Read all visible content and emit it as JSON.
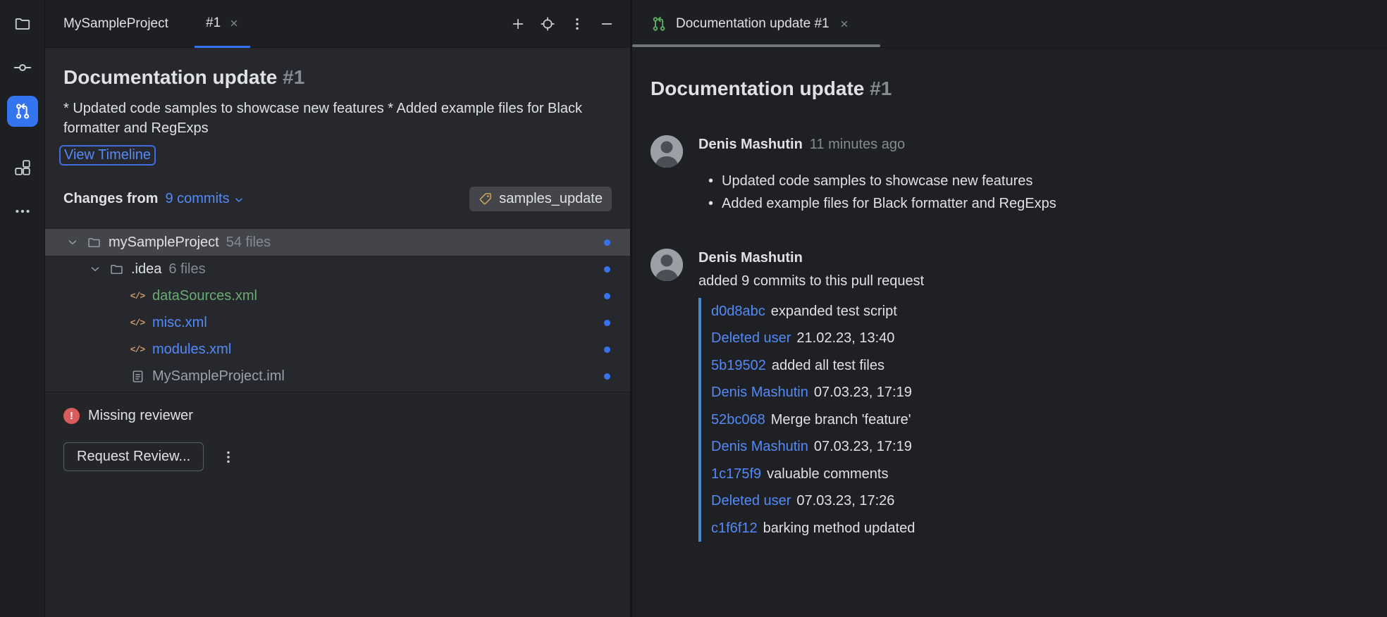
{
  "colors": {
    "accent": "#3574f0",
    "link": "#548af7",
    "added_file": "#6aab73",
    "modified_file": "#548af7",
    "warning": "#db5c5c",
    "tag_icon": "#d6ae58",
    "commit_line": "#4a88c7",
    "unviewed_dot": "#3574f0",
    "pr_tab_icon": "#5fad65"
  },
  "activity_bar": {
    "items": [
      {
        "icon": "project-folder-icon",
        "active": false
      },
      {
        "icon": "commit-icon",
        "active": false
      },
      {
        "icon": "pull-requests-icon",
        "active": true
      },
      {
        "icon": "structure-icon",
        "active": false
      },
      {
        "icon": "more-icon",
        "active": false
      }
    ]
  },
  "left_panel": {
    "window_title": "MySampleProject",
    "tab": {
      "label": "#1"
    },
    "toolbar_icons": [
      "plus-icon",
      "target-icon",
      "kebab-icon",
      "minimize-icon"
    ],
    "pr": {
      "title": "Documentation update",
      "number": "#1",
      "description": "* Updated code samples to showcase new features * Added example files for Black formatter and RegExps",
      "view_timeline_label": "View Timeline",
      "changes_label": "Changes from",
      "commits_dropdown": "9 commits",
      "tag_label": "samples_update"
    },
    "tree": [
      {
        "label": "mySampleProject",
        "meta": "54 files",
        "level": 0,
        "has_chevron": true,
        "is_folder": true,
        "selected": true,
        "color": "default"
      },
      {
        "label": ".idea",
        "meta": "6 files",
        "level": 1,
        "has_chevron": true,
        "is_folder": true,
        "color": "default"
      },
      {
        "label": "dataSources.xml",
        "meta": "",
        "level": 2,
        "is_xml": true,
        "color": "added"
      },
      {
        "label": "misc.xml",
        "meta": "",
        "level": 2,
        "is_xml": true,
        "color": "modified"
      },
      {
        "label": "modules.xml",
        "meta": "",
        "level": 2,
        "is_xml": true,
        "color": "modified"
      },
      {
        "label": "MySampleProject.iml",
        "meta": "",
        "level": 2,
        "is_file": true,
        "color": "muted"
      }
    ],
    "footer": {
      "warning": "Missing reviewer",
      "request_review_label": "Request Review..."
    }
  },
  "right_panel": {
    "tab_title": "Documentation update #1",
    "heading": {
      "title": "Documentation update",
      "number": "#1"
    },
    "post1": {
      "author": "Denis Mashutin",
      "time": "11 minutes ago",
      "bullets": [
        {
          "text": "Updated code samples to showcase new features"
        },
        {
          "text": "Added example files for Black formatter and RegExps"
        }
      ]
    },
    "post2": {
      "author": "Denis Mashutin",
      "action": "added 9 commits to this pull request",
      "commits": [
        {
          "hash": "d0d8abc",
          "message": "expanded test script",
          "author": "Deleted user",
          "date": "21.02.23, 13:40"
        },
        {
          "hash": "5b19502",
          "message": "added all test files",
          "author": "Denis Mashutin",
          "date": "07.03.23, 17:19"
        },
        {
          "hash": "52bc068",
          "message": "Merge branch 'feature'",
          "author": "Denis Mashutin",
          "date": "07.03.23, 17:19"
        },
        {
          "hash": "1c175f9",
          "message": "valuable comments",
          "author": "Deleted user",
          "date": "07.03.23, 17:26"
        },
        {
          "hash": "c1f6f12",
          "message": "barking method updated",
          "author": "",
          "date": ""
        }
      ]
    }
  }
}
